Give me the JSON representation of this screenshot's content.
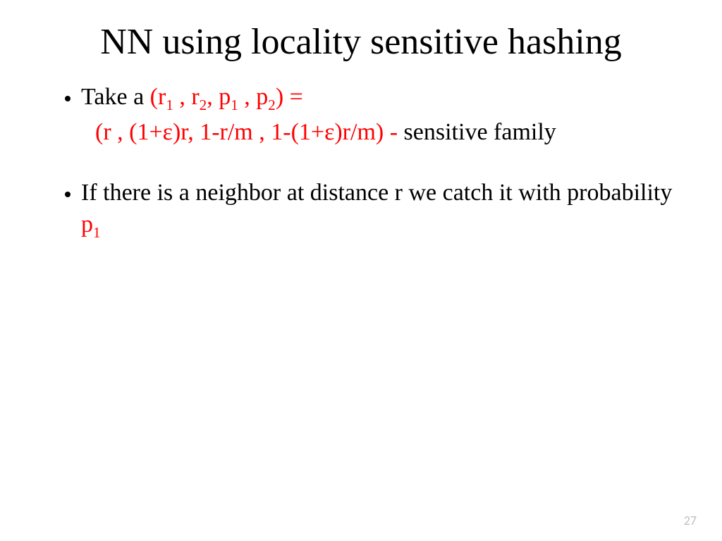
{
  "title": "NN using locality sensitive hashing",
  "bullet1": {
    "lead": "Take a ",
    "params_open": "(r",
    "params_1_sub": "1",
    "params_sep1": " , r",
    "params_2_sub": "2",
    "params_sep2": ", p",
    "params_3_sub": "1",
    "params_sep3": " , p",
    "params_4_sub": "2",
    "params_close": ") = "
  },
  "line2": {
    "vals_a": "(r , (1+",
    "eps1": "ε",
    "vals_b": ")r, 1-r/m , 1-(1+",
    "eps2": "ε",
    "vals_c": ")r/m) - ",
    "tail": "sensitive family"
  },
  "bullet2": {
    "text_a": "If there is a neighbor at distance r we catch it with probability ",
    "p": "p",
    "p_sub": "1"
  },
  "page": "27"
}
